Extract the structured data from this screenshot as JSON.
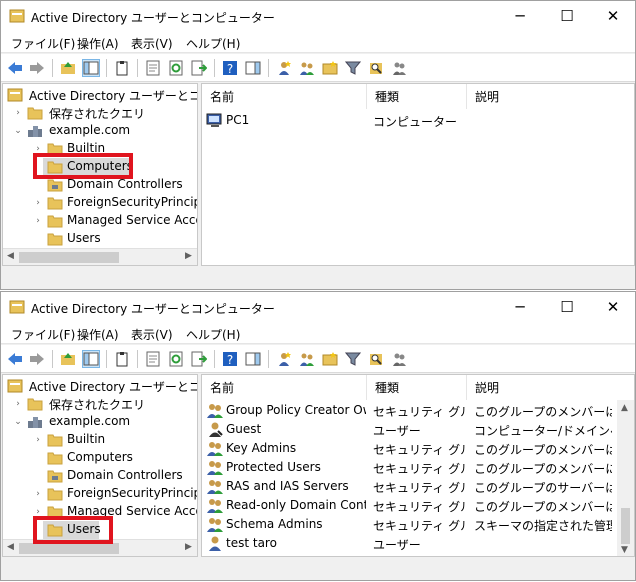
{
  "windows": [
    {
      "title": "Active Directory ユーザーとコンピューター",
      "menu": [
        "ファイル(F)",
        "操作(A)",
        "表示(V)",
        "ヘルプ(H)"
      ],
      "tree": {
        "root": "Active Directory ユーザーとコンピュー",
        "saved_queries": "保存されたクエリ",
        "domain": "example.com",
        "children": [
          "Builtin",
          "Computers",
          "Domain Controllers",
          "ForeignSecurityPrincipals",
          "Managed Service Accounts",
          "Users"
        ],
        "selected": "Computers"
      },
      "columns": [
        "名前",
        "種類",
        "説明"
      ],
      "rows": [
        {
          "icon": "computer-icon",
          "name": "PC1",
          "type": "コンピューター",
          "desc": ""
        }
      ]
    },
    {
      "title": "Active Directory ユーザーとコンピューター",
      "menu": [
        "ファイル(F)",
        "操作(A)",
        "表示(V)",
        "ヘルプ(H)"
      ],
      "tree": {
        "root": "Active Directory ユーザーとコンピュー",
        "saved_queries": "保存されたクエリ",
        "domain": "example.com",
        "children": [
          "Builtin",
          "Computers",
          "Domain Controllers",
          "ForeignSecurityPrincipals",
          "Managed Service Accounts",
          "Users"
        ],
        "selected": "Users"
      },
      "columns": [
        "名前",
        "種類",
        "説明"
      ],
      "rows": [
        {
          "icon": "group-icon",
          "name": "Group Policy Creator Ow...",
          "type": "セキュリティ グル...",
          "desc": "このグループのメンバーはドメ..."
        },
        {
          "icon": "user-icon",
          "name": "Guest",
          "type": "ユーザー",
          "desc": "コンピューター/ドメインへのゲ..."
        },
        {
          "icon": "group-icon",
          "name": "Key Admins",
          "type": "セキュリティ グル...",
          "desc": "このグループのメンバーは、ド..."
        },
        {
          "icon": "group-icon",
          "name": "Protected Users",
          "type": "セキュリティ グル...",
          "desc": "このグループのメンバーには、..."
        },
        {
          "icon": "group-icon",
          "name": "RAS and IAS Servers",
          "type": "セキュリティ グル...",
          "desc": "このグループのサーバーはユー..."
        },
        {
          "icon": "group-icon",
          "name": "Read-only Domain Contr...",
          "type": "セキュリティ グル...",
          "desc": "このグループのメンバーは、ド..."
        },
        {
          "icon": "group-icon",
          "name": "Schema Admins",
          "type": "セキュリティ グル...",
          "desc": "スキーマの指定された管理者"
        },
        {
          "icon": "user-icon",
          "name": "test taro",
          "type": "ユーザー",
          "desc": ""
        }
      ]
    }
  ],
  "window_buttons": {
    "minimize": "─",
    "maximize": "☐",
    "close": "✕"
  },
  "colors": {
    "highlight": "#e0141e",
    "folder": "#e8c35a",
    "selection": "#d9d9d9"
  }
}
